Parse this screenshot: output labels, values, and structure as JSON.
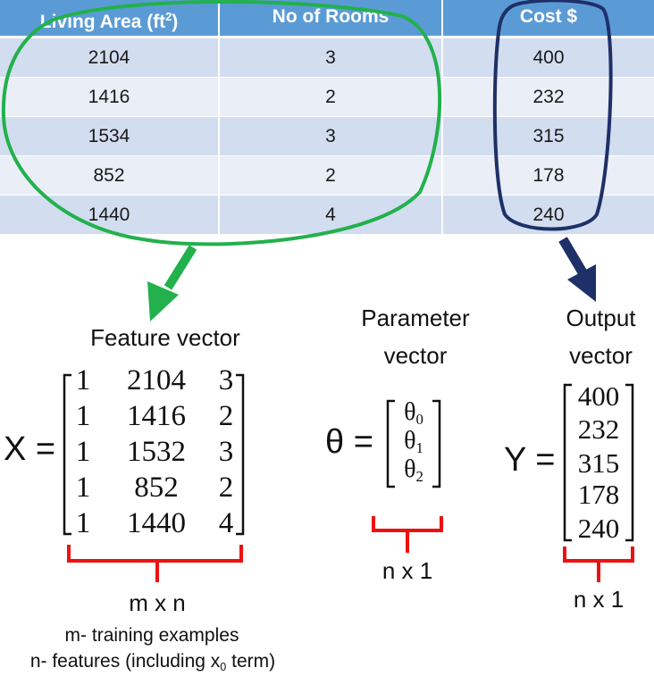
{
  "table": {
    "headers": [
      "Living Area (ft",
      "No of Rooms",
      "Cost $"
    ],
    "header_sup": "2",
    "header_close": ")",
    "rows": [
      [
        "2104",
        "3",
        "400"
      ],
      [
        "1416",
        "2",
        "232"
      ],
      [
        "1534",
        "3",
        "315"
      ],
      [
        "852",
        "2",
        "178"
      ],
      [
        "1440",
        "4",
        "240"
      ]
    ]
  },
  "feature": {
    "title": "Feature vector",
    "symbol": "X",
    "equals": "=",
    "matrix": [
      [
        "1",
        "2104",
        "3"
      ],
      [
        "1",
        "1416",
        "2"
      ],
      [
        "1",
        "1532",
        "3"
      ],
      [
        "1",
        "852",
        "2"
      ],
      [
        "1",
        "1440",
        "4"
      ]
    ],
    "dims": "m x n",
    "note1": "m- training examples",
    "note2_a": "n- features (including x",
    "note2_sub": "0",
    "note2_b": " term)"
  },
  "parameter": {
    "title_line1": "Parameter",
    "title_line2": "vector",
    "symbol": "θ",
    "equals": "=",
    "entries": [
      {
        "sym": "θ",
        "sub": "0"
      },
      {
        "sym": "θ",
        "sub": "1"
      },
      {
        "sym": "θ",
        "sub": "2"
      }
    ],
    "dims": "n x 1"
  },
  "output": {
    "title_line1": "Output",
    "title_line2": "vector",
    "symbol": "Y",
    "equals": "=",
    "entries": [
      "400",
      "232",
      "315",
      "178",
      "240"
    ],
    "dims": "n x 1"
  },
  "colors": {
    "header": "#5b9bd5",
    "row_dark": "#d2ddef",
    "row_light": "#e9eef7",
    "green": "#22b14c",
    "navy": "#1f3068",
    "red": "#ee1111"
  }
}
